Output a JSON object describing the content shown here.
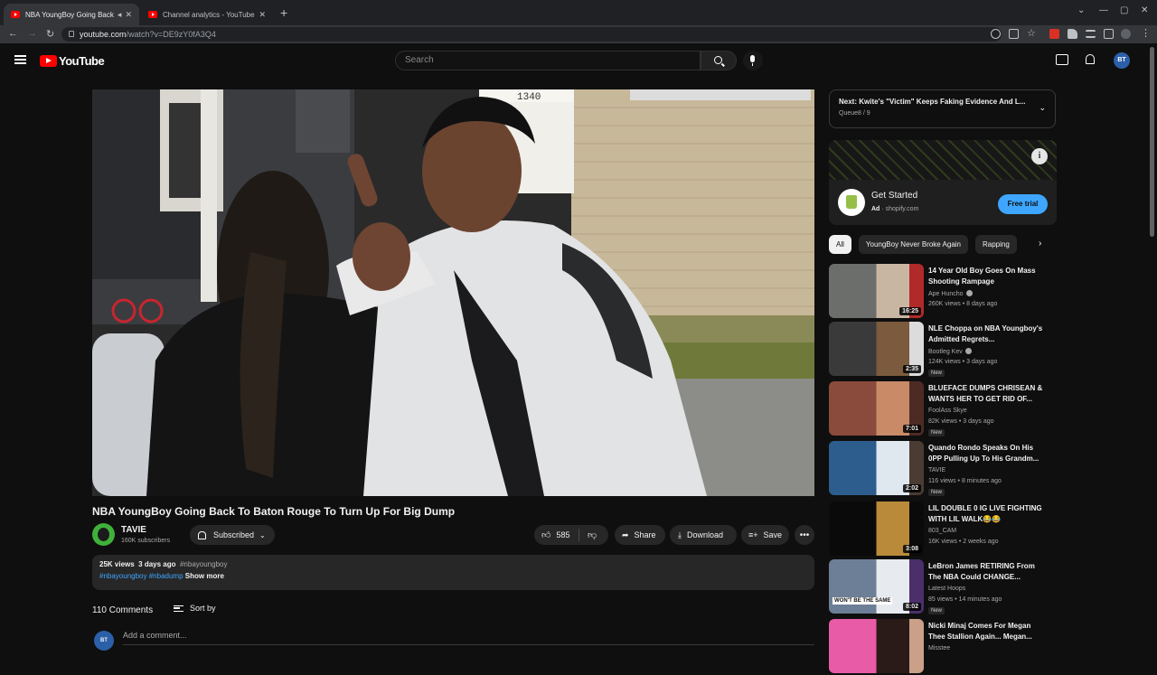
{
  "browser": {
    "tabs": [
      {
        "title": "NBA YoungBoy Going Back"
      },
      {
        "title": "Channel analytics - YouTube St"
      }
    ],
    "url_host": "youtube.com",
    "url_path": "/watch?v=DE9zY0fA3Q4"
  },
  "header": {
    "logo_text": "YouTube",
    "search_placeholder": "Search",
    "avatar_initials": "BT"
  },
  "video": {
    "title": "NBA YoungBoy Going Back To Baton Rouge To Turn Up For Big Dump",
    "channel": "TAVIE",
    "subscribers": "160K subscribers",
    "subscribed_label": "Subscribed",
    "likes": "585",
    "share_label": "Share",
    "download_label": "Download",
    "save_label": "Save",
    "views": "25K views",
    "date": "3 days ago",
    "tag1": "#nbayoungboy",
    "tag2": "#nbayoungboy",
    "tag3": "#nbadump",
    "show_more": "Show more",
    "house_number": "1340"
  },
  "comments": {
    "count_label": "110 Comments",
    "sort_label": "Sort by",
    "add_placeholder": "Add a comment...",
    "avatar_initials": "BT"
  },
  "upnext": {
    "title": "Next: Kwite's \"Victim\" Keeps Faking Evidence And L...",
    "queue": "Queue8 / 9"
  },
  "ad": {
    "title": "Get Started",
    "ad_label": "Ad",
    "domain": "shopify.com",
    "cta": "Free trial"
  },
  "chips": [
    "All",
    "YoungBoy Never Broke Again",
    "Rapping"
  ],
  "recommendations": [
    {
      "title": "14 Year Old Boy Goes On Mass Shooting Rampage",
      "channel": "Ape Huncho",
      "verified": true,
      "meta": "260K views • 8 days ago",
      "duration": "16:25",
      "badge": "",
      "colors": [
        "#6b6e6a",
        "#c9b6a2",
        "#b12a2a"
      ]
    },
    {
      "title": "NLE Choppa on NBA Youngboy's Admitted Regrets...",
      "channel": "Bootleg Kev",
      "verified": true,
      "meta": "124K views • 3 days ago",
      "duration": "2:35",
      "badge": "New",
      "colors": [
        "#3a3a3a",
        "#7b5a3e",
        "#dcdcdc"
      ]
    },
    {
      "title": "BLUEFACE DUMPS CHRISEAN & WANTS HER TO GET RID OF...",
      "channel": "FoolAss Skye",
      "verified": false,
      "meta": "82K views • 3 days ago",
      "duration": "7:01",
      "badge": "New",
      "colors": [
        "#8a4b3c",
        "#c98a68",
        "#4d2b24"
      ]
    },
    {
      "title": "Quando Rondo Speaks On His 0PP Pulling Up To His Grandm...",
      "channel": "TAVIE",
      "verified": false,
      "meta": "116 views • 8 minutes ago",
      "duration": "2:02",
      "badge": "New",
      "colors": [
        "#2d5d8c",
        "#dfe7ef",
        "#4a3b33"
      ]
    },
    {
      "title": "LIL DOUBLE 0 IG LIVE FIGHTING WITH LIL WALK😂😂",
      "channel": "803_CAM",
      "verified": false,
      "meta": "16K views • 2 weeks ago",
      "duration": "3:08",
      "badge": "",
      "colors": [
        "#0a0a0a",
        "#b88a3a",
        "#0a0a0a"
      ]
    },
    {
      "title": "LeBron James RETIRING From The NBA Could CHANGE...",
      "channel": "Latest Hoops",
      "verified": false,
      "meta": "85 views • 14 minutes ago",
      "duration": "8:02",
      "badge": "New",
      "colors": [
        "#6d7f96",
        "#e7ebef",
        "#4b2f6a"
      ]
    },
    {
      "title": "Nicki Minaj Comes For Megan Thee Stallion Again... Megan...",
      "channel": "Misstee",
      "verified": false,
      "meta": "",
      "duration": "",
      "badge": "",
      "colors": [
        "#e85ba6",
        "#2a1b18",
        "#caa088"
      ]
    }
  ],
  "rec_thumb_caption": "WON'T BE THE SAME"
}
